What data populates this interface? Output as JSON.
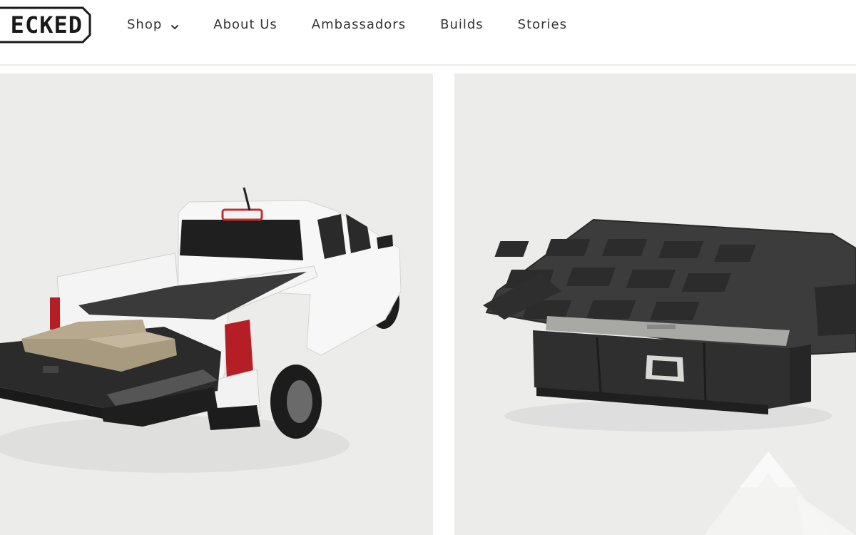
{
  "header": {
    "logo_text": "ECKED",
    "nav": [
      {
        "label": "Shop",
        "has_dropdown": true
      },
      {
        "label": "About Us"
      },
      {
        "label": "Ambassadors"
      },
      {
        "label": "Builds"
      },
      {
        "label": "Stories"
      }
    ]
  },
  "main": {
    "images": [
      {
        "subject": "white pickup truck with bed drawer system extended"
      },
      {
        "subject": "black truck bed drawer system product"
      }
    ]
  },
  "icons": {
    "nav_dropdown": "chevron-down-icon",
    "watermark": "mountain-watermark-icon"
  },
  "colors": {
    "panel_bg": "#ececeb",
    "text": "#333333",
    "header_border": "#ececec"
  }
}
